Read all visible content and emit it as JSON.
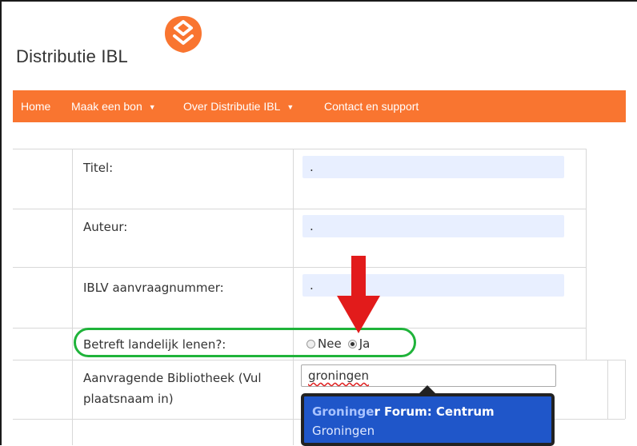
{
  "app": {
    "title": "Distributie IBL"
  },
  "nav": {
    "items": [
      {
        "label": "Home",
        "has_caret": false
      },
      {
        "label": "Maak een bon",
        "has_caret": true
      },
      {
        "label": "Over Distributie IBL",
        "has_caret": true
      },
      {
        "label": "Contact en support",
        "has_caret": false
      }
    ],
    "color": "#f97530"
  },
  "form": {
    "titel": {
      "label": "Titel:",
      "value": "."
    },
    "auteur": {
      "label": "Auteur:",
      "value": "."
    },
    "iblv": {
      "label": "IBLV aanvraagnummer:",
      "value": "."
    },
    "landelijk": {
      "label": "Betreft landelijk lenen?:",
      "options": [
        {
          "label": "Nee",
          "checked": false
        },
        {
          "label": "Ja",
          "checked": true
        }
      ]
    },
    "bibliotheek": {
      "label_line1": "Aanvragende Bibliotheek (Vul",
      "label_line2": "plaatsnaam in)",
      "value": "groningen"
    }
  },
  "autocomplete": {
    "match": "Groninge",
    "rest": "r Forum: Centrum",
    "city": "Groningen"
  },
  "annotations": {
    "arrow_color": "#e21b1b",
    "oval_color": "#1fb33a"
  }
}
